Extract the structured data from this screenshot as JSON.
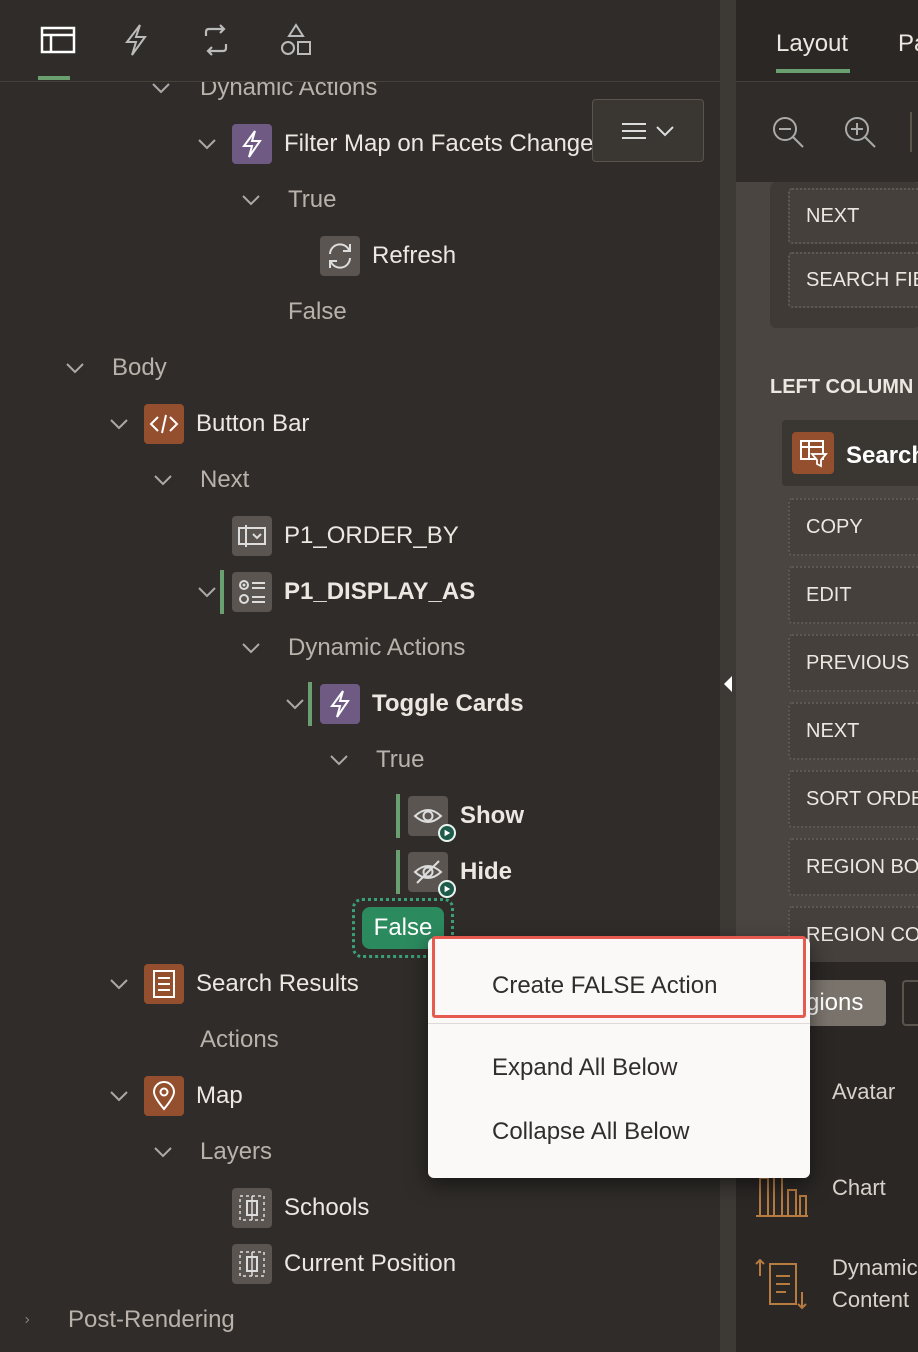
{
  "left_tabs": [
    {
      "name": "page-tab-rendering",
      "icon": "rendering-icon",
      "active": true
    },
    {
      "name": "page-tab-dynamic-actions",
      "icon": "lightning-icon",
      "active": false
    },
    {
      "name": "page-tab-processing",
      "icon": "processing-icon",
      "active": false
    },
    {
      "name": "page-tab-shared-components",
      "icon": "shapes-icon",
      "active": false
    }
  ],
  "tree": {
    "dynamic_actions_top": "Dynamic Actions",
    "filter_map": "Filter Map on Facets Change",
    "true_1": "True",
    "refresh": "Refresh",
    "false_1": "False",
    "body": "Body",
    "button_bar": "Button Bar",
    "next": "Next",
    "order_by": "P1_ORDER_BY",
    "display_as": "P1_DISPLAY_AS",
    "dynamic_actions_2": "Dynamic Actions",
    "toggle_cards": "Toggle Cards",
    "true_2": "True",
    "show": "Show",
    "hide": "Hide",
    "false_2": "False",
    "search_results": "Search Results",
    "actions": "Actions",
    "map": "Map",
    "layers": "Layers",
    "schools": "Schools",
    "current_position": "Current Position",
    "post_rendering": "Post-Rendering"
  },
  "context_menu": {
    "create_false_action": "Create FALSE Action",
    "expand_all_below": "Expand All Below",
    "collapse_all_below": "Collapse All Below",
    "highlight_color": "#e75a50"
  },
  "right_panel": {
    "tabs": [
      "Layout",
      "Pa"
    ],
    "top_slots": [
      "NEXT",
      "SEARCH FIE"
    ],
    "section": "LEFT COLUMN",
    "region_label": "Search",
    "slots": [
      "COPY",
      "EDIT",
      "PREVIOUS",
      "NEXT",
      "SORT ORDE",
      "REGION BOD",
      "REGION CON"
    ],
    "gallery_tab": "gions",
    "gallery_items": [
      "Avatar",
      "Chart",
      "Dynamic",
      "Content"
    ]
  },
  "colors": {
    "accent_green": "#6aa06f",
    "false_pill": "#2c8a5f",
    "da_purple": "#6e5a83",
    "region_brown": "#94502e"
  }
}
